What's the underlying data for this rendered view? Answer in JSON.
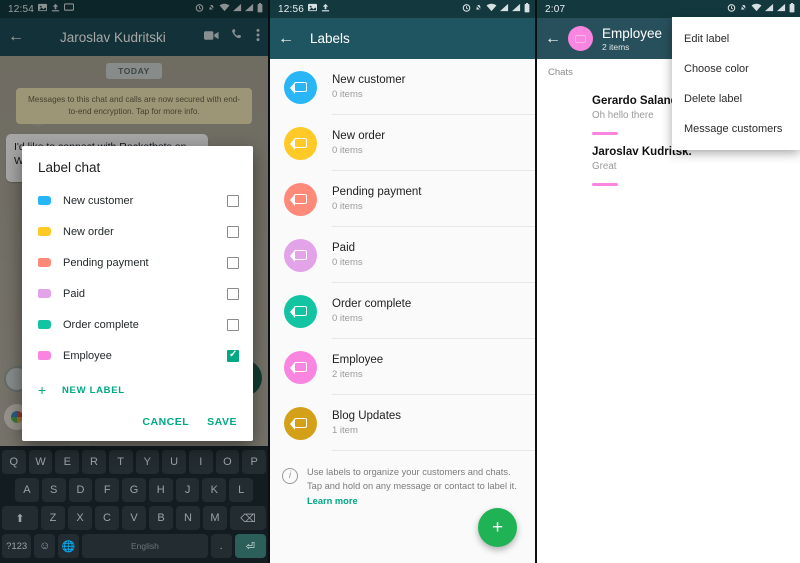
{
  "panel1": {
    "status": {
      "time": "12:54",
      "icons": [
        "image-icon",
        "upload-icon",
        "monitor-icon",
        "alarm-icon",
        "bell-off-icon",
        "wifi-icon",
        "signal-icon",
        "signal-icon",
        "battery-icon"
      ]
    },
    "appbar": {
      "title": "Jaroslav Kudritski",
      "back": "←",
      "video": "video-call-icon",
      "call": "phone-icon",
      "more": "more-vert-icon"
    },
    "chat": {
      "day_chip": "TODAY",
      "encryption_notice": "Messages to this chat and calls are now secured with end-to-end encryption. Tap for more info.",
      "message": "I'd like to connect with Rocketbots on WhatsApp 😊"
    },
    "dialog": {
      "title": "Label chat",
      "labels": [
        {
          "name": "New customer",
          "color": "#29b6f6",
          "checked": false
        },
        {
          "name": "New order",
          "color": "#ffc928",
          "checked": false
        },
        {
          "name": "Pending payment",
          "color": "#ff8a7a",
          "checked": false
        },
        {
          "name": "Paid",
          "color": "#e2a3e8",
          "checked": false
        },
        {
          "name": "Order complete",
          "color": "#13c4a3",
          "checked": false
        },
        {
          "name": "Employee",
          "color": "#f985e0",
          "checked": true
        }
      ],
      "new_label": "NEW LABEL",
      "cancel": "CANCEL",
      "save": "SAVE"
    },
    "keyboard": {
      "row1": [
        "Q",
        "W",
        "E",
        "R",
        "T",
        "Y",
        "U",
        "I",
        "O",
        "P"
      ],
      "row2": [
        "A",
        "S",
        "D",
        "F",
        "G",
        "H",
        "J",
        "K",
        "L"
      ],
      "row3": [
        "⬆",
        "Z",
        "X",
        "C",
        "V",
        "B",
        "N",
        "M",
        "⌫"
      ],
      "row4": [
        "?123",
        "☺",
        "🌐",
        "English",
        ".",
        "⏎"
      ]
    }
  },
  "panel2": {
    "status": {
      "time": "12:56"
    },
    "appbar": {
      "title": "Labels",
      "back": "←"
    },
    "labels": [
      {
        "name": "New customer",
        "count": "0 items",
        "color": "#29b6f6"
      },
      {
        "name": "New order",
        "count": "0 items",
        "color": "#ffc928"
      },
      {
        "name": "Pending payment",
        "count": "0 items",
        "color": "#ff8a7a"
      },
      {
        "name": "Paid",
        "count": "0 items",
        "color": "#e2a3e8"
      },
      {
        "name": "Order complete",
        "count": "0 items",
        "color": "#13c4a3"
      },
      {
        "name": "Employee",
        "count": "2 items",
        "color": "#f985e0"
      },
      {
        "name": "Blog Updates",
        "count": "1 item",
        "color": "#d4a017"
      }
    ],
    "hint": {
      "text": "Use labels to organize your customers and chats. Tap and hold on any message or contact to label it. ",
      "link": "Learn more"
    },
    "fab": "+"
  },
  "panel3": {
    "status": {
      "time": "2:07"
    },
    "appbar": {
      "title": "Employee",
      "subtitle": "2 items",
      "back": "←"
    },
    "section": "Chats",
    "chats": [
      {
        "name": "Gerardo Salandra",
        "preview": "Oh hello there"
      },
      {
        "name": "Jaroslav Kudritsk.",
        "preview": "Great"
      }
    ],
    "menu": [
      "Edit label",
      "Choose color",
      "Delete label",
      "Message customers"
    ]
  }
}
